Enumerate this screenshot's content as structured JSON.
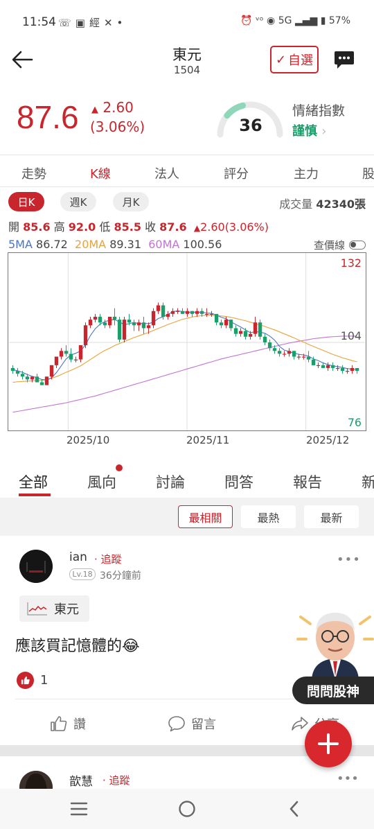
{
  "status_bar": {
    "time": "11:54",
    "battery": "57%",
    "network": "5G",
    "left_icons": [
      "missed-call-icon",
      "chat-icon",
      "news-icon",
      "x-icon",
      "dot-icon"
    ],
    "right_icons": [
      "alarm-icon",
      "volte-icon",
      "hotspot-icon",
      "signal-icon",
      "battery-icon"
    ]
  },
  "header": {
    "title": "東元",
    "code": "1504",
    "watch_label": "自選"
  },
  "quote": {
    "price": "87.6",
    "change": "2.60",
    "change_pct": "(3.06%)",
    "sentiment_title": "情緒指數",
    "sentiment_value": "36",
    "sentiment_label": "謹慎",
    "sentiment_level": 36
  },
  "tabs": [
    {
      "label": "走勢",
      "active": false
    },
    {
      "label": "K線",
      "active": true
    },
    {
      "label": "法人",
      "active": false
    },
    {
      "label": "評分",
      "active": false
    },
    {
      "label": "主力",
      "active": false
    },
    {
      "label": "股",
      "active": false
    }
  ],
  "periods": [
    {
      "label": "日K",
      "active": true
    },
    {
      "label": "週K",
      "active": false
    },
    {
      "label": "月K",
      "active": false
    }
  ],
  "volume": {
    "label": "成交量",
    "value": "42340張"
  },
  "ohlc": {
    "open_label": "開",
    "open": "85.6",
    "high_label": "高",
    "high": "92.0",
    "low_label": "低",
    "low": "85.5",
    "close_label": "收",
    "close": "87.6",
    "change": "2.60(3.06%)"
  },
  "ma": {
    "ma5_label": "5MA",
    "ma5": "86.72",
    "ma20_label": "20MA",
    "ma20": "89.31",
    "ma60_label": "60MA",
    "ma60": "100.56",
    "query_label": "查價線"
  },
  "colors": {
    "up": "#c8252c",
    "down": "#1a9e6a",
    "ma5": "#4a73c6",
    "ma20": "#e8a33b",
    "ma60": "#c272d4"
  },
  "chart_data": {
    "type": "candlestick",
    "ylim": [
      76,
      132
    ],
    "y_ticks": [
      "132",
      "104",
      "76"
    ],
    "x_ticks": [
      "2025/10",
      "2025/11",
      "2025/12"
    ],
    "candles": [
      [
        95,
        96,
        93,
        94
      ],
      [
        94,
        95,
        92,
        93
      ],
      [
        93,
        94,
        91,
        92
      ],
      [
        92,
        93,
        90,
        91
      ],
      [
        91,
        92,
        90,
        92
      ],
      [
        92,
        93,
        90,
        90
      ],
      [
        90,
        91,
        89,
        89
      ],
      [
        89,
        92,
        89,
        92
      ],
      [
        92,
        96,
        91,
        96
      ],
      [
        96,
        99,
        95,
        99
      ],
      [
        99,
        102,
        98,
        101
      ],
      [
        101,
        103,
        99,
        100
      ],
      [
        100,
        102,
        97,
        98
      ],
      [
        98,
        99,
        97,
        98
      ],
      [
        98,
        103,
        97,
        103
      ],
      [
        103,
        111,
        102,
        110
      ],
      [
        110,
        113,
        109,
        112
      ],
      [
        112,
        114,
        111,
        113
      ],
      [
        113,
        114,
        110,
        111
      ],
      [
        111,
        112,
        109,
        110
      ],
      [
        110,
        113,
        109,
        113
      ],
      [
        113,
        116,
        110,
        112
      ],
      [
        112,
        113,
        104,
        105
      ],
      [
        105,
        113,
        104,
        112
      ],
      [
        112,
        114,
        110,
        111
      ],
      [
        111,
        112,
        108,
        110
      ],
      [
        110,
        112,
        108,
        111
      ],
      [
        111,
        113,
        107,
        109
      ],
      [
        109,
        111,
        107,
        110
      ],
      [
        110,
        116,
        109,
        115
      ],
      [
        115,
        118,
        114,
        117
      ],
      [
        117,
        118,
        112,
        113
      ],
      [
        113,
        115,
        112,
        114
      ],
      [
        114,
        116,
        113,
        115
      ],
      [
        115,
        116,
        114,
        115
      ],
      [
        115,
        116,
        114,
        114
      ],
      [
        114,
        116,
        113,
        115
      ],
      [
        115,
        115,
        113,
        114
      ],
      [
        114,
        116,
        113,
        115
      ],
      [
        115,
        116,
        113,
        114
      ],
      [
        114,
        116,
        113,
        114
      ],
      [
        114,
        115,
        113,
        114
      ],
      [
        114,
        114,
        110,
        111
      ],
      [
        111,
        112,
        109,
        110
      ],
      [
        110,
        113,
        109,
        112
      ],
      [
        112,
        112,
        108,
        109
      ],
      [
        109,
        110,
        106,
        107
      ],
      [
        107,
        109,
        106,
        108
      ],
      [
        108,
        109,
        105,
        106
      ],
      [
        106,
        108,
        105,
        107
      ],
      [
        107,
        113,
        106,
        111
      ],
      [
        111,
        112,
        105,
        106
      ],
      [
        106,
        107,
        103,
        104
      ],
      [
        104,
        105,
        101,
        102
      ],
      [
        102,
        103,
        100,
        101
      ],
      [
        101,
        102,
        99,
        100
      ],
      [
        100,
        101,
        99,
        100
      ],
      [
        100,
        102,
        99,
        101
      ],
      [
        101,
        101,
        98,
        99
      ],
      [
        99,
        100,
        98,
        99
      ],
      [
        99,
        100,
        98,
        99
      ],
      [
        99,
        101,
        97,
        98
      ],
      [
        98,
        99,
        96,
        96
      ],
      [
        96,
        97,
        95,
        96
      ],
      [
        96,
        97,
        95,
        95
      ],
      [
        95,
        97,
        94,
        96
      ],
      [
        96,
        97,
        94,
        95
      ],
      [
        95,
        96,
        94,
        95
      ],
      [
        95,
        96,
        93,
        94
      ],
      [
        94,
        95,
        93,
        94
      ],
      [
        94,
        96,
        93,
        95
      ],
      [
        95,
        95,
        93,
        94
      ]
    ],
    "ma5": [
      94.5,
      94,
      93.5,
      92.7,
      92.1,
      91.6,
      91,
      90.8,
      91.6,
      93.4,
      95.8,
      98.2,
      99.6,
      100.2,
      101,
      103.2,
      106.4,
      108.8,
      110.4,
      111.3,
      111.8,
      112,
      111.2,
      110.2,
      110.6,
      111,
      110.6,
      110.7,
      110.6,
      111.1,
      112.4,
      113,
      113.8,
      114.8,
      115.1,
      114.8,
      114.6,
      114.6,
      114.6,
      114.6,
      114.3,
      114.2,
      113.6,
      112.8,
      112.3,
      111.2,
      110.3,
      109.4,
      108.4,
      107.4,
      107.8,
      107.6,
      107.2,
      106.2,
      104.8,
      102.6,
      101.3,
      100.8,
      100.2,
      99.8,
      99.6,
      99.2,
      98.2,
      97.6,
      96.8,
      96.2,
      95.8,
      95.5,
      95.2,
      94.8,
      94.6,
      94.5
    ],
    "ma20": [
      90,
      90.2,
      90.3,
      90.4,
      90.5,
      90.6,
      90.7,
      91,
      91.4,
      92,
      92.7,
      93.5,
      94.2,
      95,
      95.8,
      96.9,
      98,
      99.1,
      100.2,
      101.2,
      102,
      102.9,
      103.6,
      104.3,
      105,
      105.7,
      106.3,
      106.9,
      107.5,
      108.2,
      108.9,
      109.6,
      110.3,
      110.9,
      111.5,
      112.1,
      112.5,
      112.9,
      113.2,
      113.4,
      113.5,
      113.5,
      113.4,
      113.3,
      113.1,
      112.8,
      112.4,
      112,
      111.6,
      111.1,
      110.6,
      110.1,
      109.6,
      109,
      108.4,
      107.7,
      107,
      106.3,
      105.6,
      104.8,
      104.1,
      103.3,
      102.6,
      101.9,
      101.2,
      100.5,
      99.8,
      99.2,
      98.6,
      98.1,
      97.6,
      97.2
    ],
    "ma60": [
      79.5,
      79.8,
      80.1,
      80.4,
      80.7,
      81,
      81.3,
      81.6,
      81.9,
      82.2,
      82.5,
      82.8,
      83.2,
      83.6,
      84,
      84.4,
      84.8,
      85.2,
      85.7,
      86.2,
      86.7,
      87.2,
      87.7,
      88.2,
      88.7,
      89.2,
      89.7,
      90.2,
      90.7,
      91.2,
      91.7,
      92.2,
      92.7,
      93.2,
      93.7,
      94.2,
      94.7,
      95.2,
      95.7,
      96.2,
      96.7,
      97.2,
      97.7,
      98.2,
      98.6,
      99,
      99.4,
      99.8,
      100.2,
      100.6,
      101,
      101.4,
      101.8,
      102.2,
      102.6,
      103,
      103.4,
      103.8,
      104.1,
      104.4,
      104.7,
      105,
      105.3,
      105.5,
      105.7,
      105.9,
      106,
      106.1,
      106.2,
      106.2,
      106.2,
      106.2
    ]
  },
  "content_tabs": [
    {
      "label": "全部",
      "active": true
    },
    {
      "label": "風向",
      "active": false,
      "dot": true
    },
    {
      "label": "討論",
      "active": false
    },
    {
      "label": "問答",
      "active": false
    },
    {
      "label": "報告",
      "active": false
    },
    {
      "label": "新",
      "active": false
    }
  ],
  "sort_options": [
    {
      "label": "最相關",
      "active": true
    },
    {
      "label": "最熱",
      "active": false
    },
    {
      "label": "最新",
      "active": false
    }
  ],
  "posts": [
    {
      "user": "ian",
      "follow": "· 追蹤",
      "level": "Lv.18",
      "time": "36分鐘前",
      "stock_tag": "東元",
      "text": "應該買記憶體的😂",
      "likes": "1",
      "actions": {
        "like": "讚",
        "comment": "留言",
        "share": "分享"
      }
    },
    {
      "user": "歆慧",
      "follow": "· 追蹤"
    }
  ],
  "floating": {
    "ask_label": "問問股神",
    "fab_label": "+"
  }
}
